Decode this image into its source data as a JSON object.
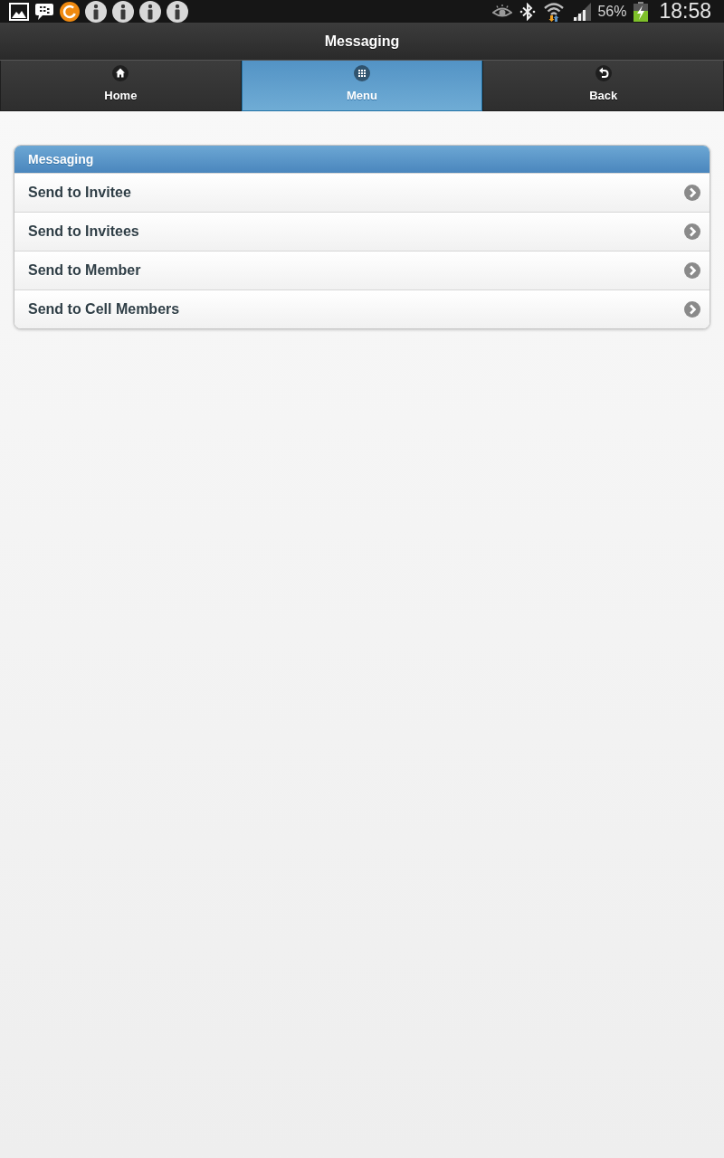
{
  "status_bar": {
    "battery": "56%",
    "time": "18:58"
  },
  "header": {
    "title": "Messaging"
  },
  "navbar": [
    {
      "label": "Home",
      "selected": false
    },
    {
      "label": "Menu",
      "selected": true
    },
    {
      "label": "Back",
      "selected": false
    }
  ],
  "listview": {
    "divider": "Messaging",
    "items": [
      "Send to Invitee",
      "Send to Invitees",
      "Send to Member",
      "Send to Cell Members"
    ]
  }
}
